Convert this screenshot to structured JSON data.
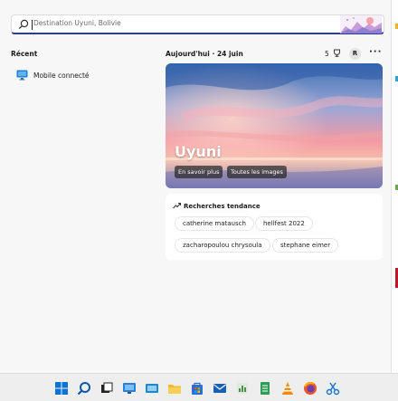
{
  "search": {
    "placeholder": "Destination Uyuni, Bolivie",
    "icon": "search-icon"
  },
  "recent": {
    "title": "Récent",
    "items": [
      {
        "label": "Mobile connecté",
        "icon": "monitor-icon"
      }
    ]
  },
  "header": {
    "today_label": "Aujourd'hui",
    "date": "24 juin",
    "weather_value": "5",
    "avatar_initial": "R",
    "more_label": "···"
  },
  "hero": {
    "title": "Uyuni",
    "buttons": [
      {
        "label": "En savoir plus"
      },
      {
        "label": "Toutes les images"
      }
    ]
  },
  "trending": {
    "title": "Recherches tendance",
    "items": [
      {
        "label": "catherine matausch"
      },
      {
        "label": "hellfest 2022"
      },
      {
        "label": "zacharopoulou chrysoula"
      },
      {
        "label": "stephane eimer"
      }
    ]
  },
  "taskbar": {
    "items": [
      {
        "name": "windows-start-icon",
        "color": "#0a74d6"
      },
      {
        "name": "search-icon",
        "color": "#0a5aa8"
      },
      {
        "name": "task-view-icon",
        "color": "#222222"
      },
      {
        "name": "widgets-icon",
        "color": "#2a7fd6"
      },
      {
        "name": "edge-icon",
        "color": "#1e88c8"
      },
      {
        "name": "file-explorer-icon",
        "color": "#f2b92a"
      },
      {
        "name": "store-icon",
        "color": "#2b6fd6"
      },
      {
        "name": "mail-icon",
        "color": "#1a5fb4"
      },
      {
        "name": "app-icon",
        "color": "#4c8f4a"
      },
      {
        "name": "notes-icon",
        "color": "#2e9b56"
      },
      {
        "name": "vlc-icon",
        "color": "#f08a10"
      },
      {
        "name": "firefox-icon",
        "color": "#e8552c"
      },
      {
        "name": "snipping-tool-icon",
        "color": "#1877c9"
      }
    ]
  },
  "colors": {
    "accent": "#2f3a8c",
    "panel": "#f7f7f7"
  }
}
